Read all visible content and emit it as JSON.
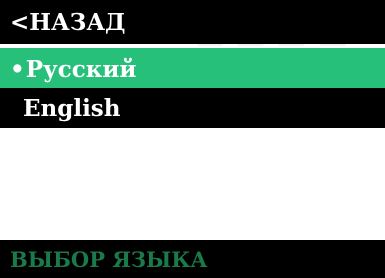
{
  "menu": {
    "back_label": "<НАЗАД",
    "items": [
      {
        "label": "Русский",
        "selected": true,
        "marker": "•"
      },
      {
        "label": "English",
        "selected": false
      }
    ]
  },
  "footer": {
    "title": "ВЫБОР ЯЗЫКА"
  },
  "colors": {
    "selected_bg": "#27c07a",
    "row_bg": "#000000",
    "footer_text": "#1a7a4a"
  }
}
